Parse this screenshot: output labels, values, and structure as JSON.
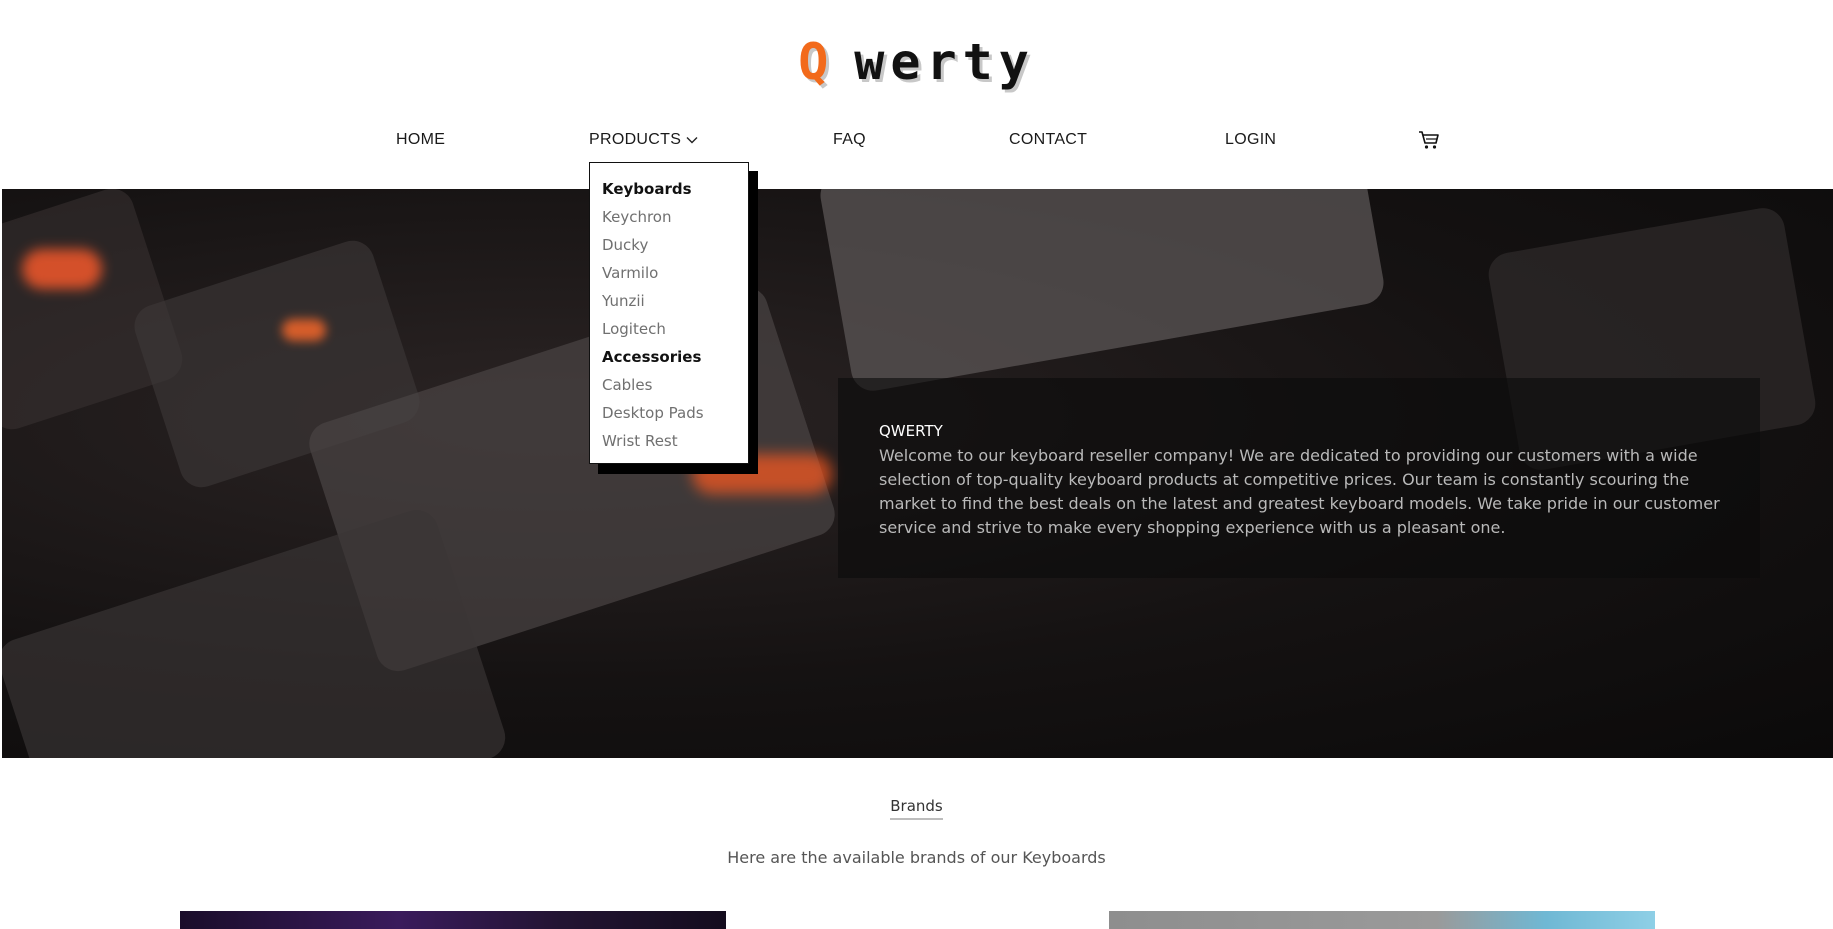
{
  "logo": {
    "first": "Q",
    "rest": "werty"
  },
  "nav": {
    "home": "HOME",
    "products": "PRODUCTS",
    "faq": "FAQ",
    "contact": "CONTACT",
    "login": "LOGIN",
    "cart_icon": "cart-icon"
  },
  "dropdown": {
    "groups": [
      {
        "heading": "Keyboards",
        "items": [
          "Keychron",
          "Ducky",
          "Varmilo",
          "Yunzii",
          "Logitech"
        ]
      },
      {
        "heading": "Accessories",
        "items": [
          "Cables",
          "Desktop Pads",
          "Wrist Rest"
        ]
      }
    ]
  },
  "hero": {
    "title": "QWERTY",
    "text": "Welcome to our keyboard reseller company! We are dedicated to providing our customers with a wide selection of top-quality keyboard products at competitive prices. Our team is constantly scouring the market to find the best deals on the latest and greatest keyboard models. We take pride in our customer service and strive to make every shopping experience with us a pleasant one."
  },
  "brands": {
    "title": "Brands",
    "description": "Here are the available brands of our Keyboards"
  },
  "colors": {
    "accent": "#f26a1b",
    "text": "#1a1a1a"
  }
}
